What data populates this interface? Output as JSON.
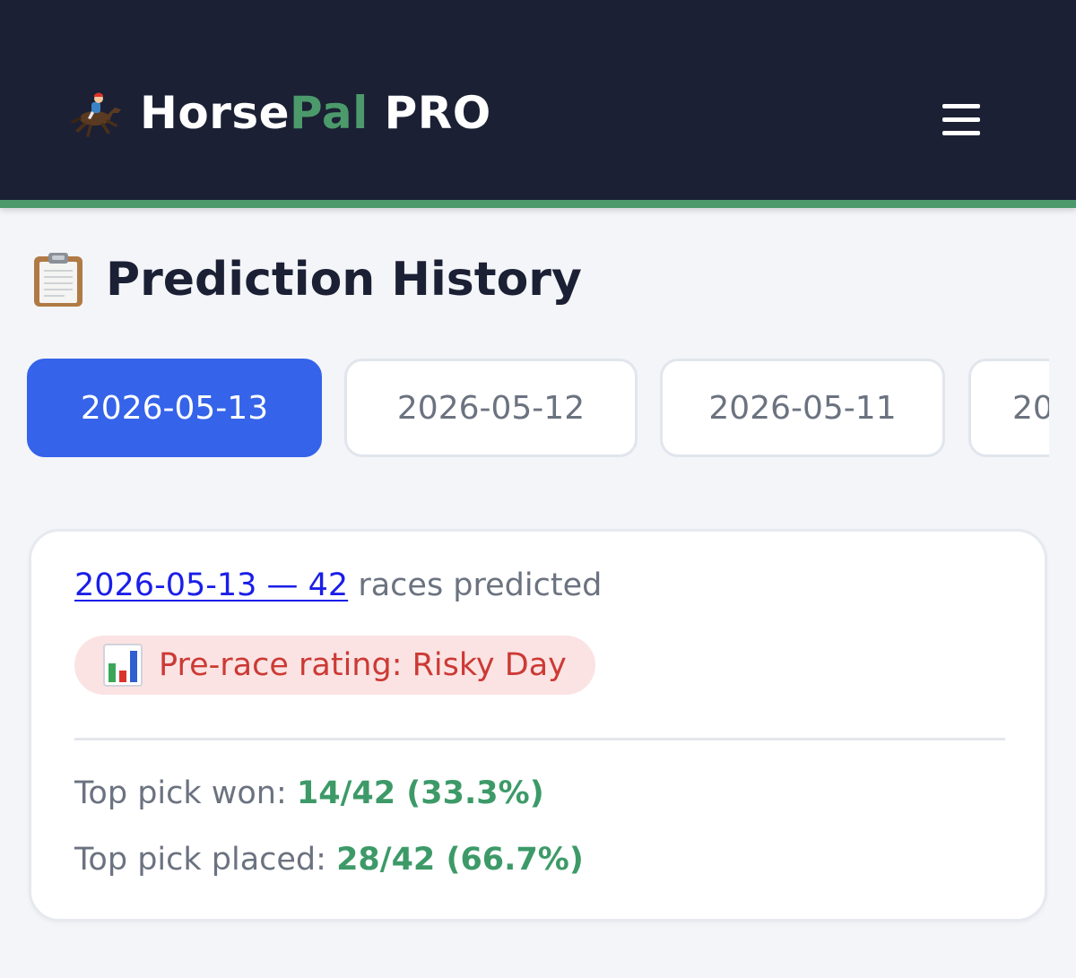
{
  "header": {
    "brand_icon": "horse-racing-icon",
    "brand_part1": "Horse",
    "brand_part2": "Pal",
    "brand_part3": " PRO",
    "menu_icon": "hamburger-menu-icon",
    "colors": {
      "background": "#1b2034",
      "accent": "#4c9a6b"
    }
  },
  "page": {
    "title_icon": "clipboard-icon",
    "title": "Prediction History"
  },
  "date_tabs": [
    {
      "label": "2026-05-13",
      "active": true
    },
    {
      "label": "2026-05-12",
      "active": false
    },
    {
      "label": "2026-05-11",
      "active": false
    },
    {
      "label": "20",
      "active": false
    }
  ],
  "card": {
    "link_text": "2026-05-13 — 42",
    "summary_suffix": " races predicted",
    "rating_icon": "bar-chart-icon",
    "rating_text": "Pre-race rating: Risky Day",
    "stats": {
      "won_label": "Top pick won: ",
      "won_value": "14/42 (33.3%)",
      "placed_label": "Top pick placed: ",
      "placed_value": "28/42 (66.7%)"
    },
    "colors": {
      "link": "#1a1ee8",
      "rating": "#cc3a35",
      "positive": "#3d9a68",
      "active_tab": "#3563e9"
    }
  }
}
